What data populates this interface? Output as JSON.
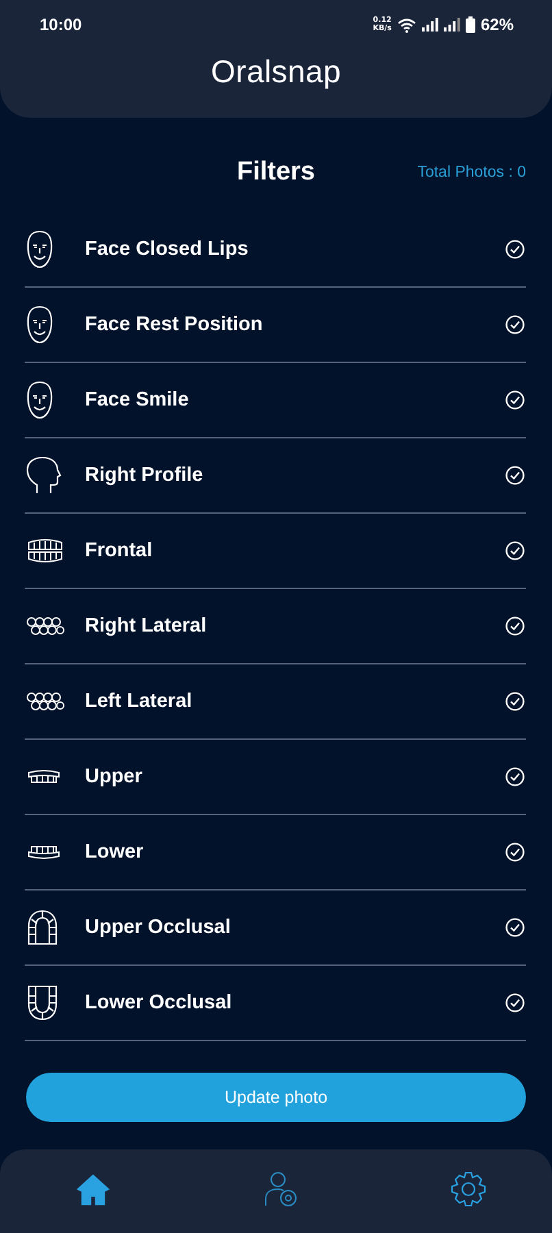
{
  "status_bar": {
    "time": "10:00",
    "speed_value": "0.12",
    "speed_unit": "KB/s",
    "battery": "62%"
  },
  "header": {
    "logo": "Oralsnap"
  },
  "title": "Filters",
  "total_photos": "Total Photos : 0",
  "filters": [
    {
      "label": "Face Closed Lips",
      "kind": "face",
      "checked": true
    },
    {
      "label": "Face Rest Position",
      "kind": "face",
      "checked": true
    },
    {
      "label": "Face Smile",
      "kind": "face",
      "checked": true
    },
    {
      "label": "Right Profile",
      "kind": "profile",
      "checked": true
    },
    {
      "label": "Frontal",
      "kind": "frontal",
      "checked": true
    },
    {
      "label": "Right Lateral",
      "kind": "lateral",
      "checked": true
    },
    {
      "label": "Left Lateral",
      "kind": "lateral",
      "checked": true
    },
    {
      "label": "Upper",
      "kind": "upper",
      "checked": true
    },
    {
      "label": "Lower",
      "kind": "lower",
      "checked": true
    },
    {
      "label": "Upper Occlusal",
      "kind": "upper_occlusal",
      "checked": true
    },
    {
      "label": "Lower Occlusal",
      "kind": "lower_occlusal",
      "checked": true
    }
  ],
  "button": "Update photo",
  "nav": [
    {
      "kind": "home",
      "selected": true
    },
    {
      "kind": "profile",
      "selected": false
    },
    {
      "kind": "settings",
      "selected": false
    }
  ]
}
